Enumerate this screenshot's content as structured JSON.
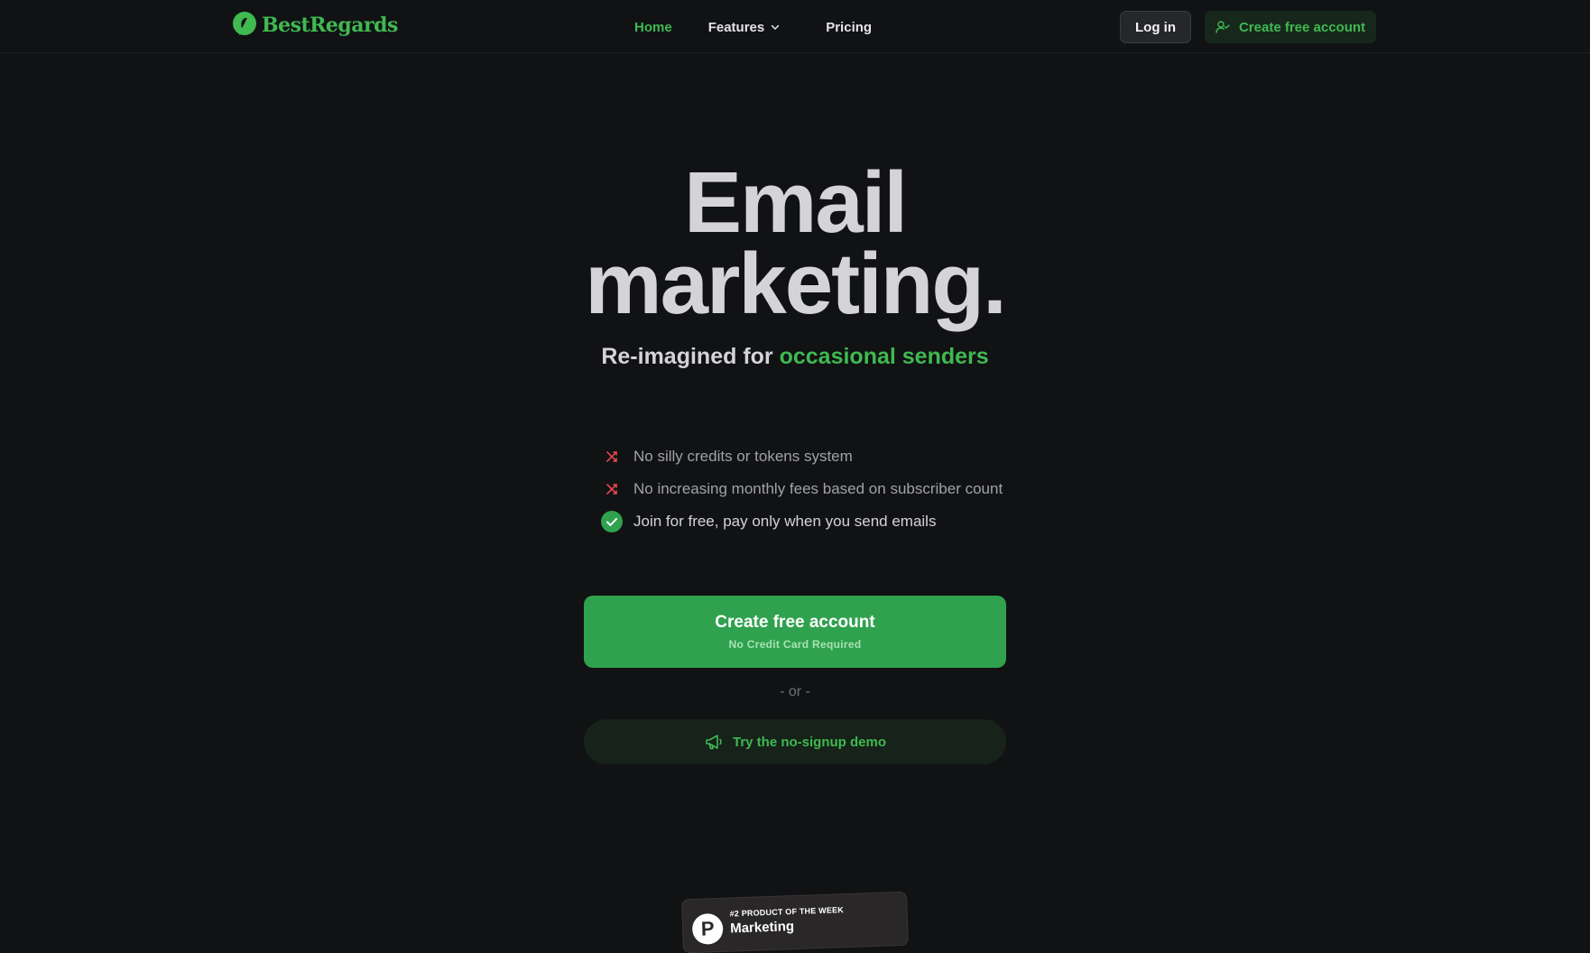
{
  "brand": {
    "name": "BestRegards",
    "color": "#3fb950"
  },
  "nav": {
    "home": "Home",
    "features": "Features",
    "pricing": "Pricing"
  },
  "header_actions": {
    "login": "Log in",
    "create_account": "Create free account"
  },
  "hero": {
    "title_line1": "Email",
    "title_line2": "marketing.",
    "subtitle_prefix": "Re-imagined for ",
    "subtitle_accent": "occasional senders"
  },
  "features": [
    {
      "text": "No silly credits or tokens system",
      "icon": "cross-arrows-icon",
      "kind": "negative"
    },
    {
      "text": "No increasing monthly fees based on subscriber count",
      "icon": "cross-arrows-icon",
      "kind": "negative"
    },
    {
      "text": "Join for free, pay only when you send emails",
      "icon": "check-circle-icon",
      "kind": "positive"
    }
  ],
  "cta": {
    "primary_label": "Create free account",
    "primary_sub": "No Credit Card Required",
    "separator": "- or -",
    "demo_label": "Try the no-signup demo"
  },
  "badge": {
    "top": "#2 PRODUCT OF THE WEEK",
    "main": "Marketing",
    "logo_letter": "P"
  },
  "colors": {
    "background": "#111214",
    "accent": "#3fb950",
    "cta": "#30a14e",
    "negative": "#e5484d"
  }
}
